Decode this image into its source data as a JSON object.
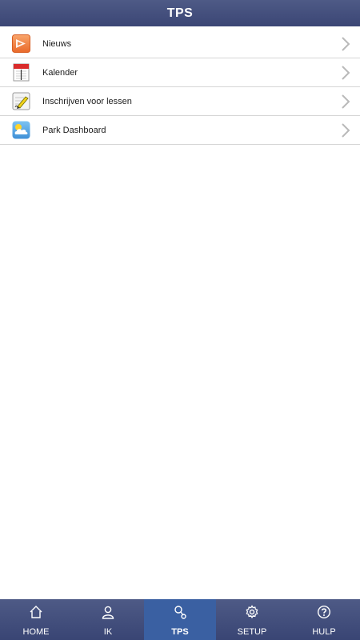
{
  "header": {
    "title": "TPS"
  },
  "menu": {
    "items": [
      {
        "label": "Nieuws",
        "icon": "news-play-icon"
      },
      {
        "label": "Kalender",
        "icon": "calendar-icon"
      },
      {
        "label": "Inschrijven voor lessen",
        "icon": "signup-pencil-icon"
      },
      {
        "label": "Park Dashboard",
        "icon": "weather-cloud-icon"
      }
    ]
  },
  "tabbar": {
    "active": "TPS",
    "tabs": [
      {
        "label": "HOME",
        "icon": "home-icon"
      },
      {
        "label": "IK",
        "icon": "user-icon"
      },
      {
        "label": "TPS",
        "icon": "tps-search-icon"
      },
      {
        "label": "SETUP",
        "icon": "gear-icon"
      },
      {
        "label": "HULP",
        "icon": "help-icon"
      }
    ]
  },
  "colors": {
    "header_bg": "#414c7a",
    "tab_active_bg": "#3a60a2",
    "divider": "#d6d6d6",
    "chevron": "#b9b9b9"
  }
}
